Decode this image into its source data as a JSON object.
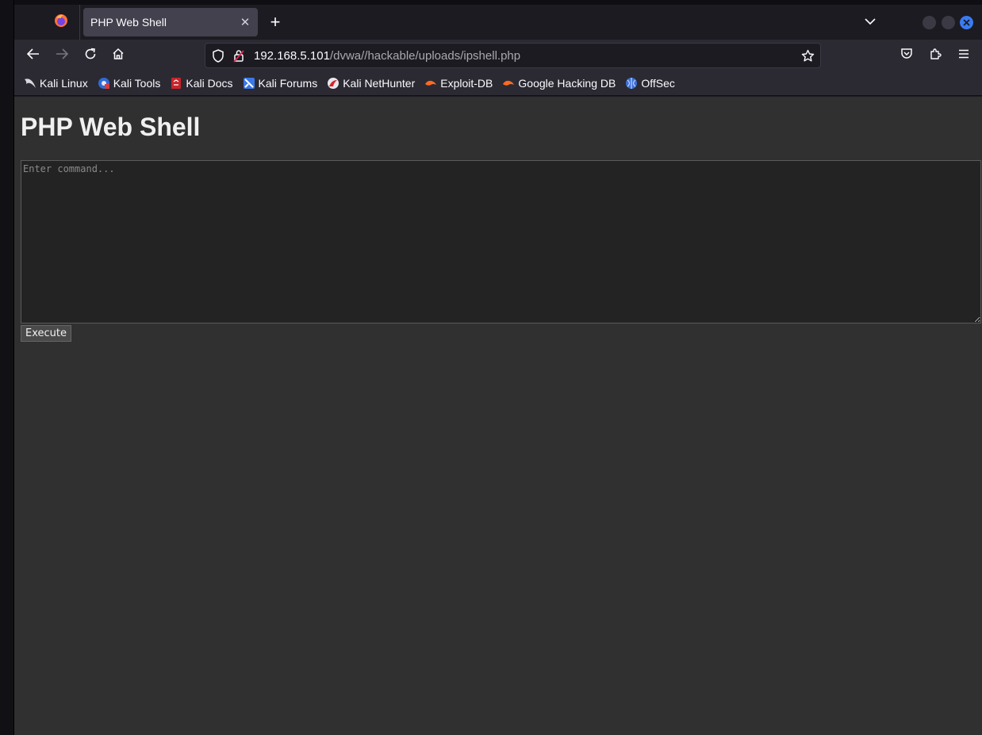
{
  "tab": {
    "title": "PHP Web Shell",
    "close_glyph": "✕",
    "new_tab_glyph": "+"
  },
  "navbar": {
    "url_host": "192.168.5.101",
    "url_path": "/dvwa//hackable/uploads/ipshell.php",
    "back_icon": "arrow-left-icon",
    "forward_icon": "arrow-right-icon",
    "reload_icon": "reload-icon",
    "home_icon": "home-icon",
    "shield_icon": "shield-icon",
    "lock_icon": "lock-icon",
    "bookmark_icon": "star-icon",
    "pocket_icon": "pocket-icon",
    "extensions_icon": "extensions-icon",
    "menu_icon": "hamburger-menu-icon"
  },
  "bookmarks": [
    {
      "label": "Kali Linux",
      "icon": "kali-dragon-icon"
    },
    {
      "label": "Kali Tools",
      "icon": "kali-tools-icon"
    },
    {
      "label": "Kali Docs",
      "icon": "kali-docs-icon"
    },
    {
      "label": "Kali Forums",
      "icon": "kali-forums-icon"
    },
    {
      "label": "Kali NetHunter",
      "icon": "kali-nethunter-icon"
    },
    {
      "label": "Exploit-DB",
      "icon": "exploit-db-icon"
    },
    {
      "label": "Google Hacking DB",
      "icon": "ghdb-icon"
    },
    {
      "label": "OffSec",
      "icon": "offsec-icon"
    }
  ],
  "page": {
    "heading": "PHP Web Shell",
    "command_placeholder": "Enter command...",
    "command_value": "",
    "execute_label": "Execute"
  },
  "colors": {
    "page_background": "#303030",
    "tab_active": "#42414d",
    "toolbar": "#2b2a33",
    "window_close": "#3a7bf2"
  }
}
